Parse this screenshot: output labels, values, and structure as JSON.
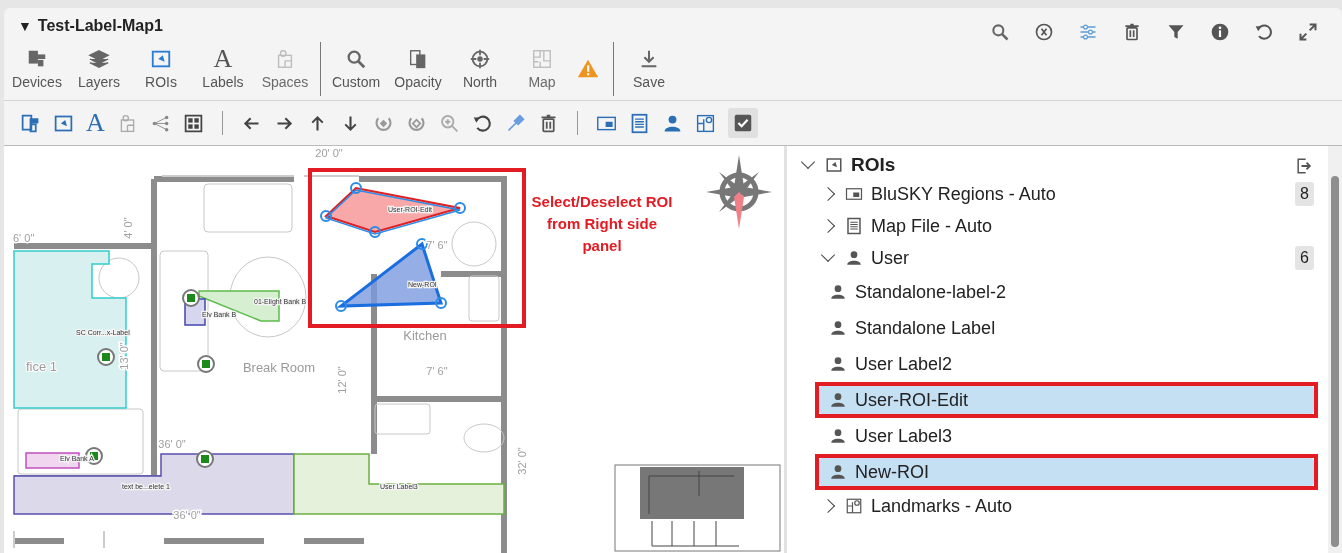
{
  "window": {
    "title_caret": "▼",
    "title": "Test-Label-Map1"
  },
  "toolbar": {
    "groups": [
      [
        {
          "label": "Devices",
          "kind": "devices",
          "selected": false,
          "disabled": false
        },
        {
          "label": "Layers",
          "kind": "layers",
          "selected": false,
          "disabled": false
        },
        {
          "label": "ROIs",
          "kind": "rois",
          "selected": true,
          "disabled": false
        },
        {
          "label": "Labels",
          "kind": "letter",
          "glyph": "A",
          "selected": false,
          "disabled": false
        },
        {
          "label": "Spaces",
          "kind": "spaces",
          "selected": false,
          "disabled": true
        }
      ],
      [
        {
          "label": "Custom",
          "kind": "search",
          "selected": false,
          "disabled": false
        },
        {
          "label": "Opacity",
          "kind": "opacity",
          "selected": false,
          "disabled": false
        },
        {
          "label": "North",
          "kind": "north",
          "selected": false,
          "disabled": false
        },
        {
          "label": "Map",
          "kind": "map",
          "selected": false,
          "disabled": true
        },
        {
          "kind": "warning"
        }
      ],
      [
        {
          "label": "Save",
          "kind": "save",
          "selected": false,
          "disabled": false
        }
      ]
    ]
  },
  "edit_toolbar": {
    "text_tool_glyph": "A",
    "edit_mode_checked": true
  },
  "map": {
    "texts": [
      {
        "kind": "dimension",
        "text": "20' 0\""
      },
      {
        "kind": "dimension",
        "text": "6' 0\""
      },
      {
        "kind": "dimension",
        "text": "4' 0\"",
        "vertical": true
      },
      {
        "kind": "dimension",
        "text": "13' 0\"",
        "vertical": true
      },
      {
        "kind": "dimension",
        "text": "12' 0\"",
        "vertical": true
      },
      {
        "kind": "dimension",
        "text": "7' 6\""
      },
      {
        "kind": "dimension",
        "text": "7' 6\""
      },
      {
        "kind": "dimension",
        "text": "36' 0\""
      },
      {
        "kind": "dimension",
        "text": "36' 0\""
      },
      {
        "kind": "dimension",
        "text": "32' 0\"",
        "vertical": true
      },
      {
        "kind": "room",
        "text": "Break Room"
      },
      {
        "kind": "room",
        "text": "Kitchen"
      },
      {
        "kind": "room",
        "text": "fice 1"
      },
      {
        "kind": "region",
        "text": "SC Corr...x-Label"
      },
      {
        "kind": "region",
        "text": "Elv Bank B"
      },
      {
        "kind": "region",
        "text": "01-Elight Bank B"
      },
      {
        "kind": "region",
        "text": "Elv Bank A"
      },
      {
        "kind": "region",
        "text": "text be...elete 1"
      },
      {
        "kind": "user",
        "text": "User Label3"
      },
      {
        "kind": "user",
        "text": "User-ROI-Edit"
      },
      {
        "kind": "user",
        "text": "New-ROI"
      }
    ],
    "annotation": "Select/Deselect ROI from Right side panel"
  },
  "tree": {
    "label": "ROIs",
    "expanded": true,
    "children": [
      {
        "label": "BluSKY Regions - Auto",
        "kind": "regions",
        "expanded": false,
        "count": "8"
      },
      {
        "label": "Map File - Auto",
        "kind": "file",
        "expanded": false
      },
      {
        "label": "User",
        "kind": "user",
        "expanded": true,
        "count": "6",
        "children": [
          {
            "label": "Standalone-label-2",
            "selected": false
          },
          {
            "label": "Standalone Label",
            "selected": false
          },
          {
            "label": "User Label2",
            "selected": false
          },
          {
            "label": "User-ROI-Edit",
            "selected": true
          },
          {
            "label": "User Label3",
            "selected": false
          },
          {
            "label": "New-ROI",
            "selected": true
          }
        ]
      },
      {
        "label": "Landmarks - Auto",
        "kind": "landmarks",
        "expanded": false
      }
    ]
  }
}
